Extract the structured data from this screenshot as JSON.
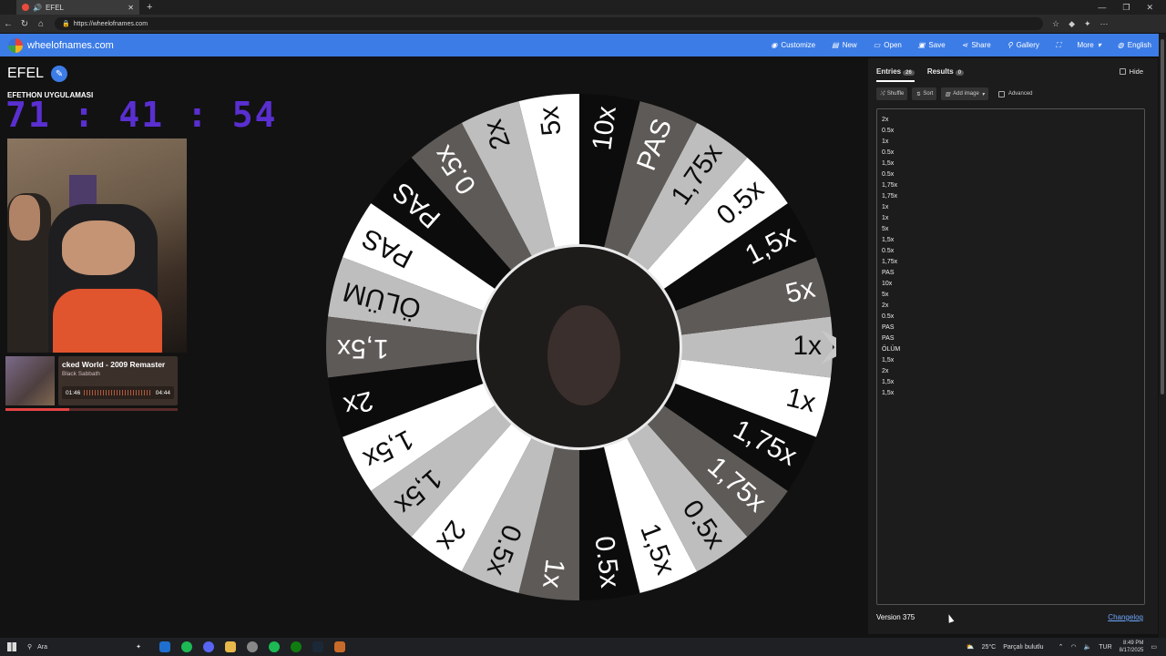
{
  "browser": {
    "tab_title": "EFEL",
    "url": "https://wheelofnames.com"
  },
  "appbar": {
    "brand": "wheelofnames.com",
    "menu": [
      {
        "label": "Customize",
        "icon": "palette-icon"
      },
      {
        "label": "New",
        "icon": "file-icon"
      },
      {
        "label": "Open",
        "icon": "folder-icon"
      },
      {
        "label": "Save",
        "icon": "save-icon"
      },
      {
        "label": "Share",
        "icon": "share-icon"
      },
      {
        "label": "Gallery",
        "icon": "search-icon"
      },
      {
        "label": "",
        "icon": "fullscreen-icon"
      },
      {
        "label": "More",
        "icon": "chevron-down-icon"
      },
      {
        "label": "English",
        "icon": "globe-icon"
      }
    ]
  },
  "page": {
    "title": "EFEL",
    "overlay_subtitle": "EFETHON UYGULAMASI",
    "timer": "71 : 41 : 54"
  },
  "music": {
    "song": "cked World - 2009 Remaster",
    "artist": "Black Sabbath",
    "elapsed": "01:46",
    "total": "04:44",
    "progress_fraction": 0.37
  },
  "wheel": {
    "colors": {
      "white": "#ffffff",
      "light": "#bebebe",
      "gray": "#5e5a57",
      "black": "#0c0c0c"
    },
    "pointer_color": "#c8c8c8",
    "slices": [
      {
        "label": "1x",
        "color": "light"
      },
      {
        "label": "5x",
        "color": "gray"
      },
      {
        "label": "1,5x",
        "color": "black"
      },
      {
        "label": "0.5x",
        "color": "white"
      },
      {
        "label": "1,75x",
        "color": "light"
      },
      {
        "label": "PAS",
        "color": "gray"
      },
      {
        "label": "10x",
        "color": "black"
      },
      {
        "label": "5x",
        "color": "white"
      },
      {
        "label": "2x",
        "color": "light"
      },
      {
        "label": "0.5x",
        "color": "gray"
      },
      {
        "label": "PAS",
        "color": "black"
      },
      {
        "label": "PAS",
        "color": "white"
      },
      {
        "label": "ÖLÜM",
        "color": "light"
      },
      {
        "label": "1,5x",
        "color": "gray"
      },
      {
        "label": "2x",
        "color": "black"
      },
      {
        "label": "1,5x",
        "color": "white"
      },
      {
        "label": "1,5x",
        "color": "light"
      },
      {
        "label": "2x",
        "color": "white"
      },
      {
        "label": "0.5x",
        "color": "light"
      },
      {
        "label": "1x",
        "color": "gray"
      },
      {
        "label": "0.5x",
        "color": "black"
      },
      {
        "label": "1,5x",
        "color": "white"
      },
      {
        "label": "0.5x",
        "color": "light"
      },
      {
        "label": "1,75x",
        "color": "gray"
      },
      {
        "label": "1,75x",
        "color": "black"
      },
      {
        "label": "1x",
        "color": "white"
      }
    ]
  },
  "panel": {
    "tab_entries": "Entries",
    "entries_count": "26",
    "tab_results": "Results",
    "results_count": "0",
    "hide_label": "Hide",
    "shuffle": "Shuffle",
    "sort": "Sort",
    "add_image": "Add image",
    "advanced": "Advanced",
    "entries": [
      "2x",
      "0.5x",
      "1x",
      "0.5x",
      "1,5x",
      "0.5x",
      "1,75x",
      "1,75x",
      "1x",
      "1x",
      "5x",
      "1,5x",
      "0.5x",
      "1,75x",
      "PAS",
      "10x",
      "5x",
      "2x",
      "0.5x",
      "PAS",
      "PAS",
      "ÖLÜM",
      "1,5x",
      "2x",
      "1,5x",
      "1,5x"
    ],
    "version": "Version 375",
    "changelog": "Changelog"
  },
  "taskbar": {
    "search_placeholder": "Ara",
    "weather": "25°C",
    "weather_desc": "Parçalı bulutlu",
    "lang": "TUR",
    "time": "8:49 PM",
    "date": "8/17/2025"
  }
}
